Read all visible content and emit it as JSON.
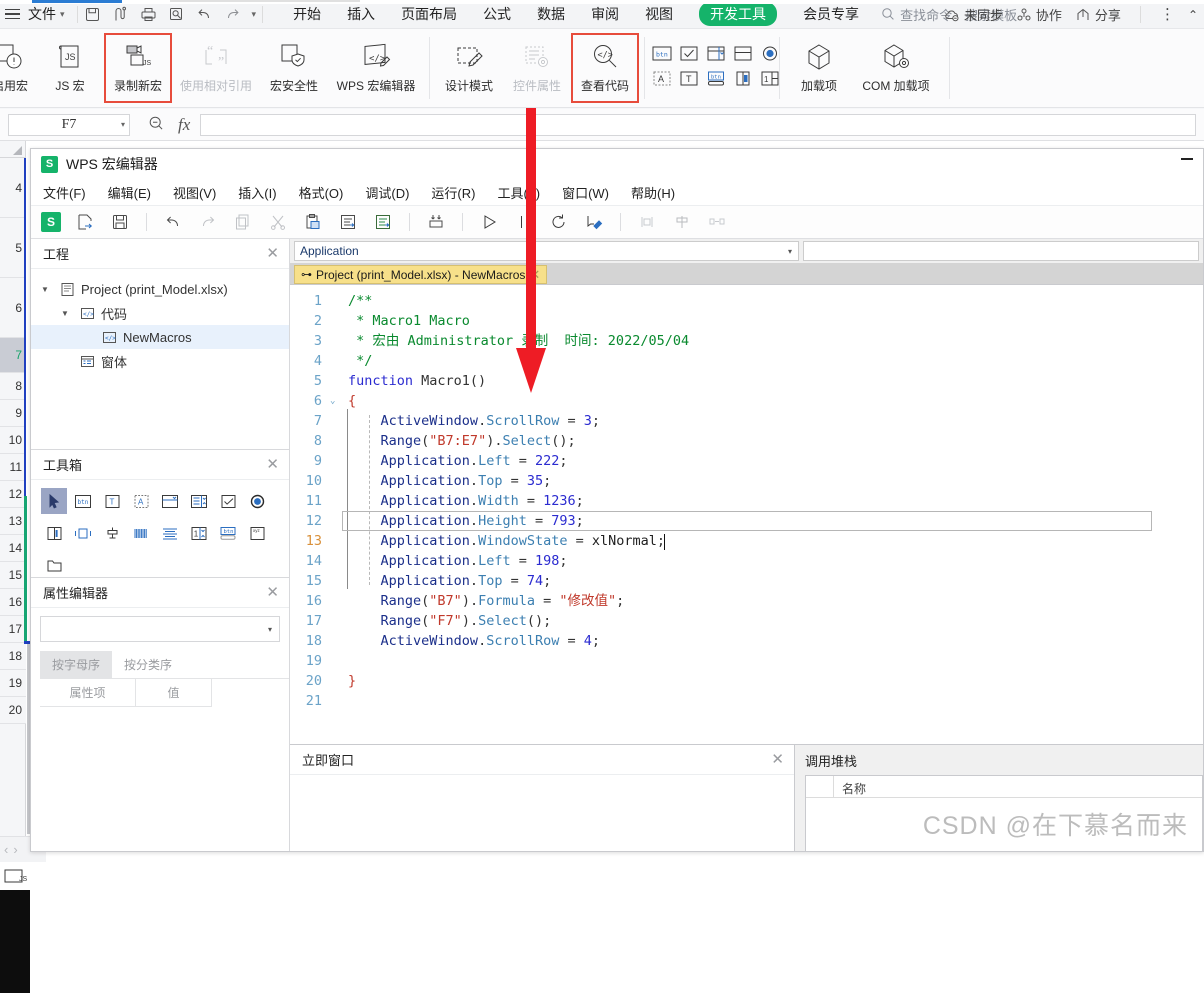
{
  "app": {
    "file_menu": "文件",
    "quick_access": [
      "save-icon",
      "save-as-icon",
      "print-icon",
      "print-preview-icon",
      "undo-icon",
      "redo-icon",
      "customize-qat-icon"
    ],
    "tabs": [
      {
        "label": "开始",
        "selected": false
      },
      {
        "label": "插入",
        "selected": false
      },
      {
        "label": "页面布局",
        "selected": false
      },
      {
        "label": "公式",
        "selected": false
      },
      {
        "label": "数据",
        "selected": false
      },
      {
        "label": "审阅",
        "selected": false
      },
      {
        "label": "视图",
        "selected": false
      },
      {
        "label": "开发工具",
        "selected": true
      },
      {
        "label": "会员专享",
        "selected": false
      }
    ],
    "search_placeholder": "查找命令、搜索模板",
    "status_items": [
      {
        "label": "未同步",
        "icon": "cloud-off-icon"
      },
      {
        "label": "协作",
        "icon": "collaborate-icon"
      },
      {
        "label": "分享",
        "icon": "share-icon"
      }
    ],
    "more_icon": "more-vertical-icon",
    "collapse_icon": "chevron-up-icon",
    "accent_green": "#15b36a",
    "highlight_red": "#e74c3c"
  },
  "ribbon": {
    "groups": [
      {
        "items": [
          {
            "label": "启用宏",
            "icon": "enable-macro-icon",
            "disabled": false,
            "highlight": false,
            "truncated": true
          },
          {
            "label": "JS 宏",
            "icon": "js-macro-icon",
            "disabled": false,
            "highlight": false
          },
          {
            "label": "录制新宏",
            "icon": "record-macro-icon",
            "disabled": false,
            "highlight": true
          },
          {
            "label": "使用相对引用",
            "icon": "relative-ref-icon",
            "disabled": true,
            "highlight": false
          },
          {
            "label": "宏安全性",
            "icon": "macro-security-icon",
            "disabled": false,
            "highlight": false
          },
          {
            "label": "WPS 宏编辑器",
            "icon": "wps-macro-editor-icon",
            "disabled": false,
            "highlight": false
          }
        ]
      },
      {
        "items": [
          {
            "label": "设计模式",
            "icon": "design-mode-icon",
            "disabled": false,
            "highlight": false
          },
          {
            "label": "控件属性",
            "icon": "control-properties-icon",
            "disabled": true,
            "highlight": false
          },
          {
            "label": "查看代码",
            "icon": "view-code-icon",
            "disabled": false,
            "highlight": true
          }
        ]
      },
      {
        "controls": [
          "button-control-icon",
          "checkbox-control-icon",
          "combobox-control-icon",
          "listbox-control-icon",
          "optionbutton-control-icon",
          "label-control-icon",
          "textbox-control-icon",
          "togglebutton-control-icon",
          "scrollbar-control-icon",
          "spinbutton-control-icon"
        ]
      },
      {
        "items": [
          {
            "label": "加载项",
            "icon": "addins-icon",
            "disabled": false,
            "highlight": false
          },
          {
            "label": "COM 加载项",
            "icon": "com-addins-icon",
            "disabled": false,
            "highlight": false
          }
        ]
      }
    ]
  },
  "formula_bar": {
    "name_box_value": "F7",
    "zoom_icon": "zoom-out-icon",
    "fx_icon": "fx-icon",
    "formula_value": ""
  },
  "sheet": {
    "row_headers": [
      "4",
      "5",
      "6",
      "7",
      "8",
      "9",
      "10",
      "11",
      "12",
      "13",
      "14",
      "15",
      "16",
      "17",
      "18",
      "19",
      "20"
    ],
    "selected_row": "7"
  },
  "editor": {
    "title": "WPS 宏编辑器",
    "logo_text": "S",
    "minimize_icon": "minimize-icon",
    "menus": [
      "文件(F)",
      "编辑(E)",
      "视图(V)",
      "插入(I)",
      "格式(O)",
      "调试(D)",
      "运行(R)",
      "工具(T)",
      "窗口(W)",
      "帮助(H)"
    ],
    "toolbar_icons": [
      "wps-logo-icon",
      "export-icon",
      "save-icon",
      "undo-icon",
      "redo-icon",
      "copy-icon",
      "cut-icon",
      "paste-icon",
      "indent-icon",
      "outdent-icon",
      "bookmark-icon",
      "run-icon",
      "pause-icon",
      "reset-icon",
      "design-mode-icon",
      "align-left-icon",
      "align-center-icon",
      "align-distribute-icon"
    ],
    "project_pane": {
      "title": "工程",
      "close_icon": "close-icon",
      "tree": [
        {
          "label": "Project (print_Model.xlsx)",
          "level": 1,
          "icon": "project-icon",
          "expanded": true,
          "selected": false
        },
        {
          "label": "代码",
          "level": 2,
          "icon": "code-module-icon",
          "expanded": true,
          "selected": false
        },
        {
          "label": "NewMacros",
          "level": 3,
          "icon": "code-module-icon",
          "expanded": null,
          "selected": true
        },
        {
          "label": "窗体",
          "level": 2,
          "icon": "form-icon",
          "expanded": null,
          "selected": false
        }
      ]
    },
    "toolbox_pane": {
      "title": "工具箱",
      "close_icon": "close-icon",
      "tools_row1": [
        "pointer-tool-icon",
        "button-tool-icon",
        "textbox-tool-icon",
        "label-tool-icon",
        "combobox-tool-icon",
        "listbox-tool-icon",
        "checkbox-tool-icon",
        "optionbutton-tool-icon"
      ],
      "tools_row2": [
        "frame-tool-icon",
        "togglebutton-tool-icon",
        "spinbutton-tool-icon",
        "scrollbar-tool-icon",
        "multipage-tool-icon",
        "refedit-tool-icon",
        "commandbutton-tool-icon",
        "image-tool-icon"
      ],
      "tools_row3": [
        "folder-tool-icon"
      ]
    },
    "properties_pane": {
      "title": "属性编辑器",
      "close_icon": "close-icon",
      "combo_value": "",
      "tabs": [
        {
          "label": "按字母序",
          "active": true
        },
        {
          "label": "按分类序",
          "active": false
        }
      ],
      "columns": [
        "属性项",
        "值"
      ]
    },
    "code_view": {
      "object_combo": "Application",
      "proc_combo": "",
      "tab_label": "Project (print_Model.xlsx) - NewMacros",
      "tab_close_icon": "close-icon",
      "tab_pin_icon": "pin-icon",
      "current_line": 13,
      "cursor_line_number": 13,
      "lines": [
        {
          "n": 1,
          "text": "/**"
        },
        {
          "n": 2,
          "text": " * Macro1 Macro"
        },
        {
          "n": 3,
          "text": " * 宏由 Administrator 录制  时间: 2022/05/04"
        },
        {
          "n": 4,
          "text": " */"
        },
        {
          "n": 5,
          "text": "function Macro1()"
        },
        {
          "n": 6,
          "text": "{"
        },
        {
          "n": 7,
          "text": "    ActiveWindow.ScrollRow = 3;"
        },
        {
          "n": 8,
          "text": "    Range(\"B7:E7\").Select();"
        },
        {
          "n": 9,
          "text": "    Application.Left = 222;"
        },
        {
          "n": 10,
          "text": "    Application.Top = 35;"
        },
        {
          "n": 11,
          "text": "    Application.Width = 1236;"
        },
        {
          "n": 12,
          "text": "    Application.Height = 793;"
        },
        {
          "n": 13,
          "text": "    Application.WindowState = xlNormal;"
        },
        {
          "n": 14,
          "text": "    Application.Left = 198;"
        },
        {
          "n": 15,
          "text": "    Application.Top = 74;"
        },
        {
          "n": 16,
          "text": "    Range(\"B7\").Formula = \"修改值\";"
        },
        {
          "n": 17,
          "text": "    Range(\"F7\").Select();"
        },
        {
          "n": 18,
          "text": "    ActiveWindow.ScrollRow = 4;"
        },
        {
          "n": 19,
          "text": ""
        },
        {
          "n": 20,
          "text": "}"
        },
        {
          "n": 21,
          "text": ""
        }
      ]
    },
    "immediate_pane": {
      "title": "立即窗口",
      "close_icon": "close-icon",
      "content": ""
    },
    "callstack_pane": {
      "title": "调用堆栈",
      "columns": [
        "名称"
      ]
    }
  },
  "watermark": "CSDN @在下慕名而来",
  "annotation": {
    "arrow_color": "#ee1c25",
    "arrow_name": "red-down-arrow"
  }
}
